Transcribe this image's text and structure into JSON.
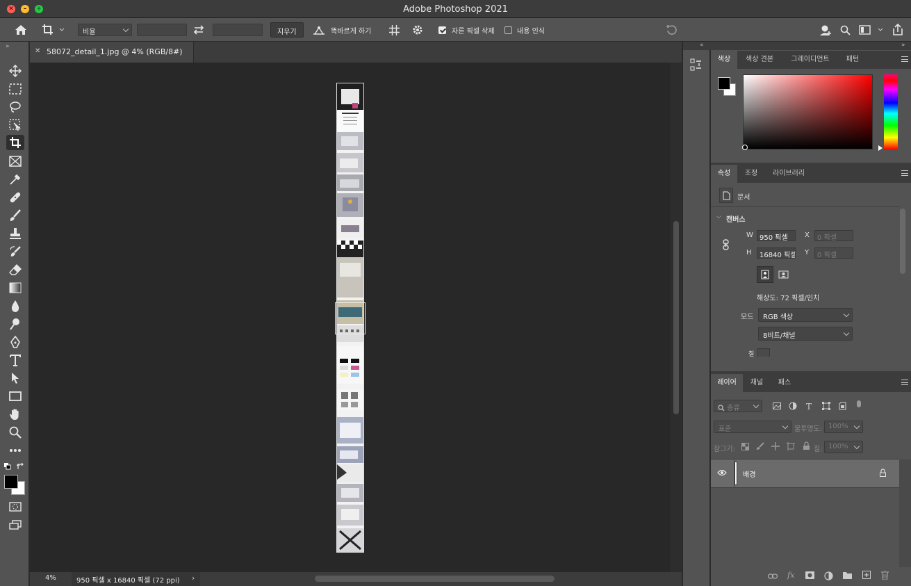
{
  "window": {
    "title": "Adobe Photoshop 2021"
  },
  "options": {
    "ratio": "비율",
    "clear": "지우기",
    "straighten": "똑바르게 하기",
    "delete_cropped": "자른 픽셀 삭제",
    "content_aware": "내용 인식",
    "delete_cropped_checked": true,
    "content_aware_checked": false
  },
  "document": {
    "tab": "58072_detail_1.jpg @ 4% (RGB/8#)",
    "zoom": "4%",
    "info": "950 픽셀 x 16840 픽셀 (72 ppi)"
  },
  "color_panel": {
    "tabs": [
      "색상",
      "색상 견본",
      "그레이디언트",
      "패턴"
    ],
    "active": "색상",
    "base_hue": "#ff0000"
  },
  "properties": {
    "tabs": [
      "속성",
      "조정",
      "라이브러리"
    ],
    "doc_label": "문서",
    "canvas": "캔버스",
    "w_label": "W",
    "w_value": "950 픽셀",
    "h_label": "H",
    "h_value": "16840 픽셀",
    "x_label": "X",
    "x_placeholder": "0 픽셀",
    "y_label": "Y",
    "y_placeholder": "0 픽셀",
    "resolution": "해상도: 72 픽셀/인치",
    "mode_label": "모드",
    "mode": "RGB 색상",
    "depth": "8비트/채널",
    "partial": "칠"
  },
  "layers": {
    "tabs": [
      "레이어",
      "채널",
      "패스"
    ],
    "filter": "종류",
    "blend": "표준",
    "opacity_label": "불투명도:",
    "opacity": "100%",
    "lock_label": "잠그기:",
    "fill_label": "칠:",
    "fill": "100%",
    "items": [
      {
        "name": "배경",
        "visible": true,
        "locked": true
      }
    ]
  }
}
